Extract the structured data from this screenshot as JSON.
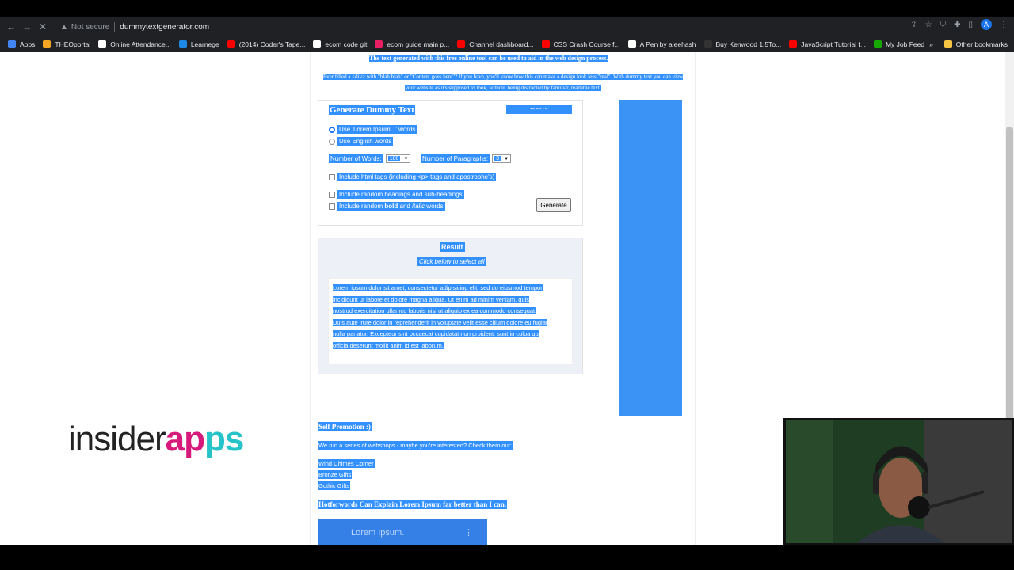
{
  "browser": {
    "security": "Not secure",
    "url": "dummytextgenerator.com",
    "avatar_letter": "A",
    "bookmarks": [
      {
        "label": "Apps",
        "color": "#4285f4"
      },
      {
        "label": "THEOportal",
        "color": "#f5a623"
      },
      {
        "label": "Online Attendance...",
        "color": "#ffffff"
      },
      {
        "label": "Learnege",
        "color": "#1e88e5"
      },
      {
        "label": "(2014) Coder's Tape...",
        "color": "#ff0000"
      },
      {
        "label": "ecom code git",
        "color": "#ffffff"
      },
      {
        "label": "ecom guide main p...",
        "color": "#e91e63"
      },
      {
        "label": "Channel dashboard...",
        "color": "#ff0000"
      },
      {
        "label": "CSS Crash Course f...",
        "color": "#ff0000"
      },
      {
        "label": "A Pen by aleehash",
        "color": "#ffffff"
      },
      {
        "label": "Buy Kenwood 1.5To...",
        "color": "#333333"
      },
      {
        "label": "JavaScript Tutorial f...",
        "color": "#ff0000"
      },
      {
        "label": "My Job Feed",
        "color": "#14a800"
      }
    ],
    "more_bookmarks": "»",
    "other_bookmarks": "Other bookmarks"
  },
  "page": {
    "intro_line1": "The text generated with this free online tool can be used to aid in the web design process.",
    "intro_line2": "Ever filled a <div> with \"blah blah\" or \"Content goes here\"? If you have, you'll know how this can make a design look less \"real\". With dummy text you can view your website as it's supposed to look, without being distracted by familiar, readable text.",
    "generator": {
      "title": "Generate Dummy Text",
      "radio_lorem": "Use 'Lorem Ipsum...' words",
      "radio_english": "Use English words",
      "words_label": "Number of Words:",
      "words_value": "100",
      "paragraphs_label": "Number of Paragraphs:",
      "paragraphs_value": "3",
      "chk_html": "Include html tags (including <p> tags and apostrophe's)",
      "chk_headings": "Include random headings and sub-headings",
      "chk_bold_pre": "Include random ",
      "chk_bold_b": "bold",
      "chk_bold_mid": " and ",
      "chk_bold_i": "italic",
      "chk_bold_post": " words",
      "generate_label": "Generate"
    },
    "result": {
      "title": "Result",
      "hint": "Click below to select all",
      "lines": [
        "Lorem ipsum dolor sit amet, consectetur adipisicing elit, sed do eiusmod tempor",
        "incididunt ut labore et dolore magna aliqua. Ut enim ad minim veniam, quis",
        "nostrud exercitation ullamco laboris nisi ut aliquip ex ea commodo consequat.",
        "Duis aute irure dolor in reprehenderit in voluptate velit esse cillum dolore eu fugiat",
        "nulla pariatur. Excepteur sint occaecat cupidatat non proident, sunt in culpa qui",
        "officia deserunt mollit anim id est laborum."
      ]
    },
    "promo": {
      "title": "Self Promotion :)",
      "text": "We run a series of webshops - maybe you're interested? Check them out:",
      "shops": [
        "Wind Chimes Corner",
        "Bronze Gifts",
        "Gothic Gifts"
      ],
      "hotwords": "Hotforwords Can Explain Lorem Ipsum far better than I can.",
      "video_title": "Lorem Ipsum.",
      "video_menu": "⋮"
    }
  },
  "overlay": {
    "logo_a": "insider",
    "logo_b": "ap",
    "logo_c": "ps"
  }
}
